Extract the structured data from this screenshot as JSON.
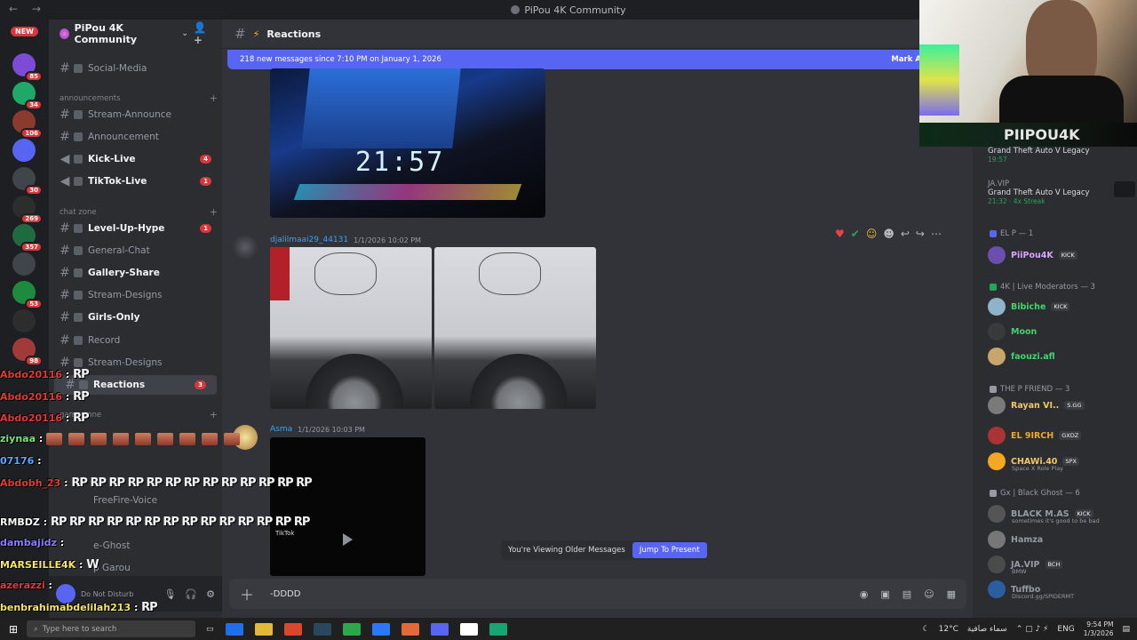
{
  "titlebar": {
    "title": "PiPou 4K Community",
    "nav": "← →"
  },
  "rail": {
    "new_label": "NEW",
    "servers": [
      {
        "count": "85",
        "color": "#7d4bd6"
      },
      {
        "count": "34",
        "color": "#1ea86a"
      },
      {
        "count": "106",
        "color": "#8b3a2e"
      },
      {
        "count": "",
        "color": "#5865f2"
      },
      {
        "count": "30",
        "color": "#40444b"
      },
      {
        "count": "269",
        "color": "#2d2d2d"
      },
      {
        "count": "357",
        "color": "#1d6b3e"
      },
      {
        "count": "",
        "color": "#40444b"
      },
      {
        "count": "53",
        "color": "#1d8a3f"
      },
      {
        "count": "",
        "color": "#2d2d2d"
      },
      {
        "count": "98",
        "color": "#a23a3a"
      }
    ]
  },
  "sidebar": {
    "server_name": "PiPou 4K Community",
    "channels": [
      {
        "label": "Social-Media",
        "type": "text",
        "state": "read",
        "badge": ""
      },
      {
        "label": "Stream-Announce",
        "type": "text",
        "state": "read",
        "badge": ""
      },
      {
        "label": "Announcement",
        "type": "text",
        "state": "read",
        "badge": ""
      },
      {
        "label": "Kick-Live",
        "type": "voice",
        "state": "unread",
        "badge": "4"
      },
      {
        "label": "TikTok-Live",
        "type": "voice",
        "state": "unread",
        "badge": "1"
      },
      {
        "label": "Level-Up-Hype",
        "type": "text",
        "state": "unread",
        "badge": "1"
      },
      {
        "label": "General-Chat",
        "type": "text",
        "state": "read",
        "badge": ""
      },
      {
        "label": "Gallery-Share",
        "type": "text",
        "state": "unread",
        "badge": ""
      },
      {
        "label": "Stream-Designs",
        "type": "text",
        "state": "read",
        "badge": ""
      },
      {
        "label": "Girls-Only",
        "type": "text",
        "state": "unread",
        "badge": ""
      },
      {
        "label": "Record",
        "type": "text",
        "state": "read",
        "badge": ""
      },
      {
        "label": "Stream-Designs",
        "type": "text",
        "state": "read",
        "badge": ""
      },
      {
        "label": "Reactions",
        "type": "text",
        "state": "active",
        "badge": "3"
      }
    ],
    "categories": [
      {
        "label": "announcements"
      },
      {
        "label": "chat zone"
      },
      {
        "label": "game zone"
      }
    ],
    "voice_lower": [
      {
        "label": "FreeFire-Voice"
      },
      {
        "label": "e-Ghost"
      },
      {
        "label": "p Garou"
      }
    ]
  },
  "user_panel": {
    "status": "Do Not Disturb"
  },
  "chat": {
    "channel_name": "Reactions",
    "new_messages_banner": "218 new messages since 7:10 PM on January 1, 2026",
    "mark_as_read": "Mark As",
    "clock_in_image": "21:57",
    "messages": [
      {
        "user": "djalilmaai29_44131",
        "timestamp": "1/1/2026 10:02 PM",
        "color": "#3ba3f7"
      },
      {
        "user": "Asma",
        "timestamp": "1/1/2026 10:03 PM",
        "color": "#3ba3f7"
      }
    ],
    "video_label": "TikTok",
    "older_text": "You're Viewing Older Messages",
    "jump_label": "Jump To Present",
    "composer_value": "-DDDD"
  },
  "members": {
    "activities": [
      {
        "game": "Grand Theft Auto V Legacy",
        "time": "19:57",
        "name": ""
      },
      {
        "name": "JA.VIP",
        "game": "Grand Theft Auto V Legacy",
        "time": "21:32",
        "streak": "4x Streak"
      }
    ],
    "groups": [
      {
        "label": "EL P — 1",
        "color": "#5865f2"
      },
      {
        "label": "4K | Live Moderators — 3",
        "color": "#23a55a"
      },
      {
        "label": "THE P FRIEND — 3",
        "color": "#949ba4"
      },
      {
        "label": "Gx | Black Ghost — 6",
        "color": "#949ba4"
      }
    ],
    "list": [
      {
        "name": "PiiPou4K",
        "color": "#d6a6ff",
        "tag": "KICK",
        "sub": ""
      },
      {
        "name": "Bibiche",
        "color": "#45d46b",
        "tag": "KICK",
        "sub": ""
      },
      {
        "name": "Moon",
        "color": "#45d46b",
        "tag": "",
        "sub": ""
      },
      {
        "name": "faouzi.afl",
        "color": "#45d46b",
        "tag": "",
        "sub": ""
      },
      {
        "name": "Rayan VI..",
        "color": "#f2c76a",
        "tag": "S.GG",
        "sub": ""
      },
      {
        "name": "EL 9IRCH",
        "color": "#f5a623",
        "tag": "GXDZ",
        "sub": ""
      },
      {
        "name": "CHAWi.40",
        "color": "#f2c76a",
        "tag": "SPX",
        "sub": "Space X Role Play"
      },
      {
        "name": "BLACK M.AS",
        "color": "#949ba4",
        "tag": "KICK",
        "sub": "sometimes it's good to be bad"
      },
      {
        "name": "Hamza",
        "color": "#949ba4",
        "tag": "",
        "sub": ""
      },
      {
        "name": "JA.VIP",
        "color": "#949ba4",
        "tag": "BCH",
        "sub": "BMW"
      },
      {
        "name": "Tuffbo",
        "color": "#949ba4",
        "tag": "",
        "sub": "Discord.gg/SPIDERMT"
      }
    ]
  },
  "webcam": {
    "brand": "PIIPOU4K"
  },
  "overlay_chat": [
    {
      "user": "Abdo20116",
      "color": "#e53935",
      "msg": "RP"
    },
    {
      "user": "Abdo20116",
      "color": "#e53935",
      "msg": "RP"
    },
    {
      "user": "Abdo20116",
      "color": "#e53935",
      "msg": "RP"
    },
    {
      "user": "ziynaa",
      "color": "#7ee07e",
      "msg": ""
    },
    {
      "user": "07176",
      "color": "#5fa8ff",
      "msg": ""
    },
    {
      "user": "Abdobh_23",
      "color": "#e53935",
      "msg": "RP RP RP RP RP RP RP RP RP RP RP RP RP"
    },
    {
      "user": "RMBDZ",
      "color": "#ffffff",
      "msg": "RP RP RP RP RP RP RP RP RP RP RP RP RP RP"
    },
    {
      "user": "dambajidz",
      "color": "#8a7cff",
      "msg": ""
    },
    {
      "user": "MARSEILLE4K",
      "color": "#f5e663",
      "msg": "W"
    },
    {
      "user": "azerazzi",
      "color": "#e53935",
      "msg": ""
    },
    {
      "user": "benbrahimabdelilah213",
      "color": "#f5e663",
      "msg": "RP"
    }
  ],
  "taskbar": {
    "search_placeholder": "Type here to search",
    "weather": "12°C",
    "weather_desc": "سماء صافية",
    "lang": "ENG",
    "time": "9:54 PM",
    "date": "1/3/2026",
    "apps": [
      "#1f6feb",
      "#e2b93b",
      "#d9482b",
      "#2a475e",
      "#2aa84a",
      "#2978ff",
      "#e3683a",
      "#5865f2",
      "#ffffff",
      "#17a673"
    ]
  }
}
